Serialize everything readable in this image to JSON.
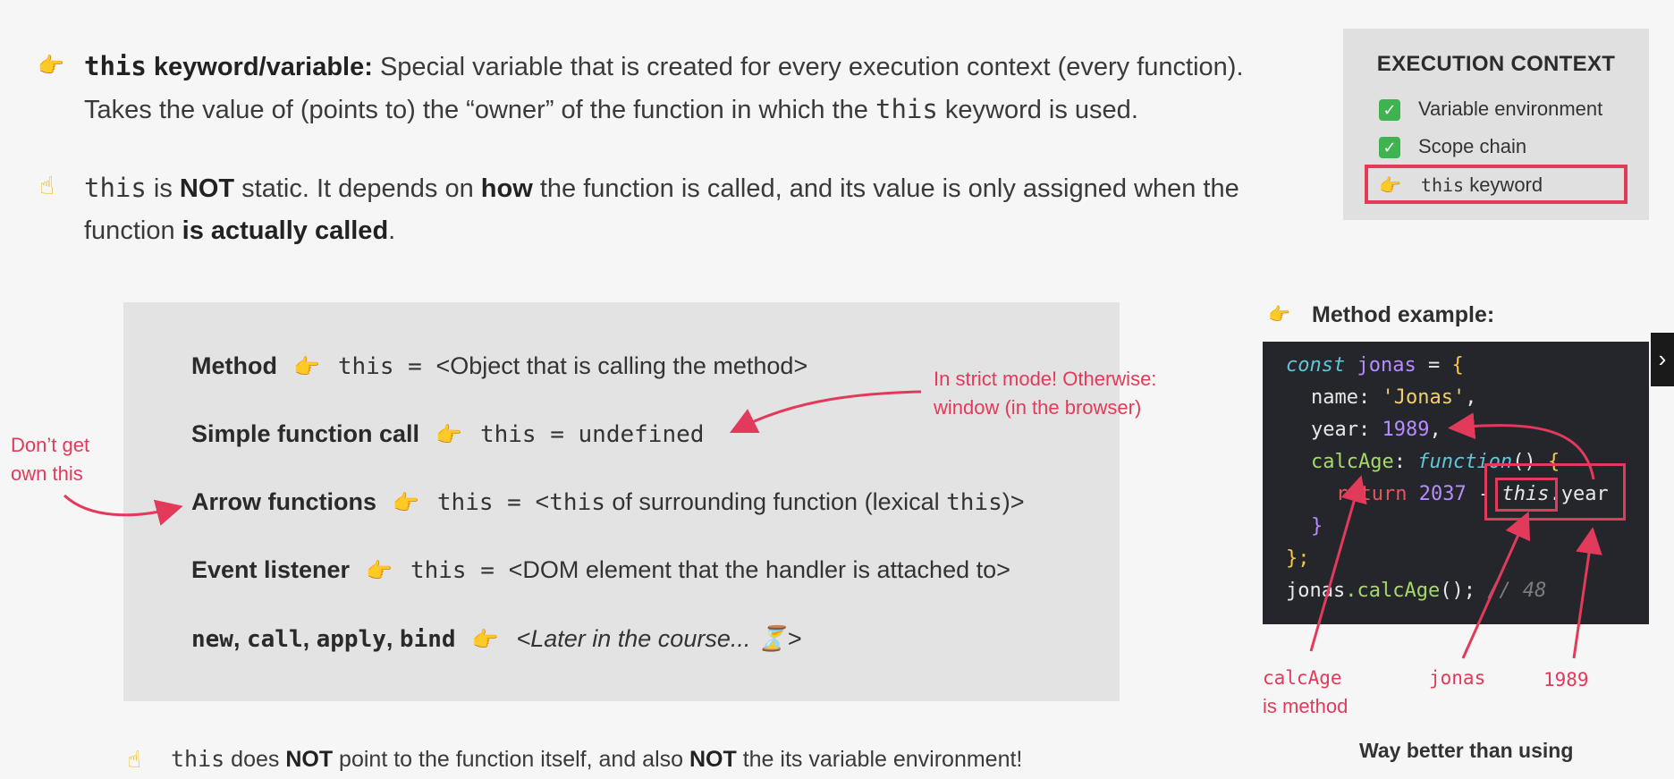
{
  "bullets": {
    "b1_term": "this",
    "b1_label": " keyword/variable:",
    "b1_text": " Special variable that is created for every execution context (every function).",
    "b1_line2_pre": "Takes the value of (points to) the “owner” of the function in which the ",
    "b1_line2_code": "this",
    "b1_line2_post": " keyword is used.",
    "b2_code": "this",
    "b2_is": " is ",
    "b2_not": "NOT",
    "b2_text1": " static. It depends on ",
    "b2_how": "how",
    "b2_text2": " the function is called, and its value is only assigned when the",
    "b2_line2_pre": "function ",
    "b2_line2_bold": "is actually called",
    "b2_line2_post": "."
  },
  "execution_context": {
    "title": "EXECUTION CONTEXT",
    "items": [
      "Variable environment",
      "Scope chain"
    ],
    "highlight_code": "this",
    "highlight_text": " keyword"
  },
  "rules": [
    {
      "label": "Method",
      "code": "this",
      "eq": " = ",
      "value": "<Object that is calling the method>"
    },
    {
      "label": "Simple function call",
      "code": "this",
      "eq": " = ",
      "value": "undefined"
    },
    {
      "label": "Arrow functions",
      "code": "this",
      "eq": " = ",
      "value_pre": "<",
      "value_code": "this",
      "value_post": " of surrounding function (lexical ",
      "value_code2": "this",
      "value_end": ")>"
    },
    {
      "label": "Event listener",
      "code": "this",
      "eq": " = ",
      "value": "<DOM element that the handler is attached to>"
    },
    {
      "label_parts": [
        "new",
        ", ",
        "call",
        ", ",
        "apply",
        ", ",
        "bind"
      ],
      "value": "<Later in the course... ⏳>"
    }
  ],
  "notes": {
    "strict_line1": "In strict mode! Otherwise:",
    "strict_line2": "window (in the browser)",
    "arrow_line1": "Don’t get",
    "arrow_line2": "own this"
  },
  "method_example": {
    "title": "Method example:",
    "labels": {
      "calcage_1": "calcAge",
      "calcage_2": "is method",
      "jonas": "jonas",
      "year": "1989"
    },
    "footer": "Way better than using"
  },
  "code": {
    "l1_kw": "const",
    "l1_var": "jonas",
    "l1_eq": " = ",
    "l1_brace": "{",
    "l2_prop": "name",
    "l2_colon": ": ",
    "l2_str": "'Jonas'",
    "l2_comma": ",",
    "l3_prop": "year",
    "l3_colon": ": ",
    "l3_num": "1989",
    "l3_comma": ",",
    "l4_prop": "calcAge",
    "l4_colon": ": ",
    "l4_kw": "function",
    "l4_paren": "() ",
    "l4_brace": "{",
    "l5_ret": "return",
    "l5_num": " 2037",
    "l5_minus": " - ",
    "l5_this": "this",
    "l5_year": ".year",
    "l6_brace": "}",
    "l7_brace": "};",
    "l8_obj": "jonas",
    "l8_call": ".calcAge",
    "l8_paren": "(); ",
    "l8_cmt": "// 48"
  },
  "bottom": {
    "code": "this",
    "t1": " does ",
    "not1": "NOT",
    "t2": " point to the function itself, and also ",
    "not2": "NOT",
    "t3": " the its variable environment!"
  },
  "icons": [
    "hand-pointing-right-icon",
    "hand-pointing-up-icon",
    "check-icon",
    "chevron-right-icon",
    "hourglass-icon"
  ],
  "colors": {
    "accent_red": "#e23a5b",
    "check_green": "#3fb34f",
    "code_bg": "#24262b",
    "rules_bg": "#e3e3e3",
    "hand_yellow": "#f1b400"
  }
}
